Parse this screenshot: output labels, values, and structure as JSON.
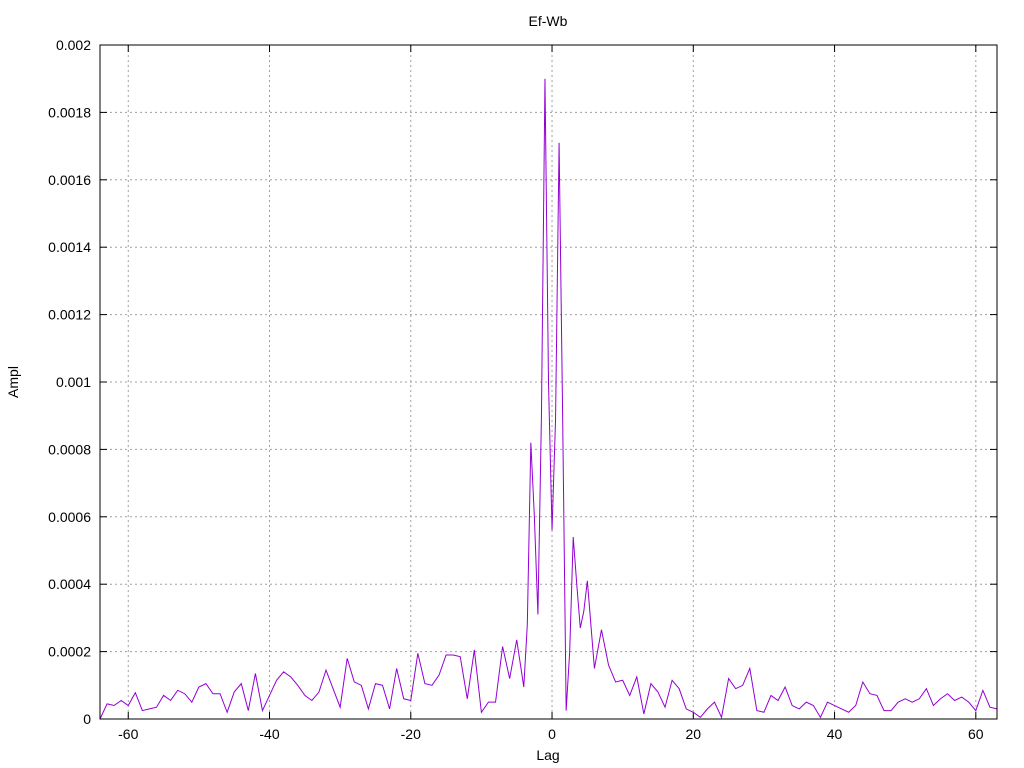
{
  "chart_data": {
    "type": "line",
    "title": "Ef-Wb",
    "xlabel": "Lag",
    "ylabel": "Ampl",
    "xlim": [
      -64,
      63
    ],
    "ylim": [
      0,
      0.002
    ],
    "grid": true,
    "line_color": "#9400d3",
    "x_ticks": [
      -60,
      -40,
      -20,
      0,
      20,
      40,
      60
    ],
    "x_tick_labels": [
      "-60",
      "-40",
      "-20",
      "0",
      "20",
      "40",
      "60"
    ],
    "y_ticks": [
      0,
      0.0002,
      0.0004,
      0.0006,
      0.0008,
      0.001,
      0.0012,
      0.0014,
      0.0016,
      0.0018,
      0.002
    ],
    "y_tick_labels": [
      "0",
      "0.0002",
      "0.0004",
      "0.0006",
      "0.0008",
      "0.001",
      "0.0012",
      "0.0014",
      "0.0016",
      "0.0018",
      "0.002"
    ],
    "series": [
      {
        "x": [
          -64,
          -63,
          -62,
          -61,
          -60,
          -59,
          -58,
          -57,
          -56,
          -55,
          -54,
          -53,
          -52,
          -51,
          -50,
          -49,
          -48,
          -47,
          -46,
          -45,
          -44,
          -43,
          -42,
          -41,
          -40,
          -39,
          -38,
          -37,
          -36,
          -35,
          -34,
          -33,
          -32,
          -31,
          -30,
          -29,
          -28,
          -27,
          -26,
          -25,
          -24,
          -23,
          -22,
          -21,
          -20,
          -19,
          -18,
          -17,
          -16,
          -15,
          -14,
          -13,
          -12,
          -11,
          -10,
          -9,
          -8,
          -7,
          -6,
          -5,
          -4,
          -3.5,
          -3,
          -2.5,
          -2,
          -1.5,
          -1,
          -0.5,
          0,
          0.5,
          1,
          1.5,
          2,
          2.5,
          3,
          3.5,
          4,
          4.5,
          5,
          6,
          7,
          8,
          9,
          10,
          11,
          12,
          13,
          14,
          15,
          16,
          17,
          18,
          19,
          20,
          21,
          22,
          23,
          24,
          25,
          26,
          27,
          28,
          29,
          30,
          31,
          32,
          33,
          34,
          35,
          36,
          37,
          38,
          39,
          40,
          41,
          42,
          43,
          44,
          45,
          46,
          47,
          48,
          49,
          50,
          51,
          52,
          53,
          54,
          55,
          56,
          57,
          58,
          59,
          60,
          61,
          62,
          63
        ],
        "y": [
          0.0,
          4.5e-05,
          4e-05,
          5.5e-05,
          4e-05,
          7.8e-05,
          2.5e-05,
          3e-05,
          3.5e-05,
          7e-05,
          5.5e-05,
          8.5e-05,
          7.5e-05,
          5e-05,
          9.5e-05,
          0.000105,
          7.5e-05,
          7.5e-05,
          2e-05,
          8e-05,
          0.000105,
          2.5e-05,
          0.000135,
          2.5e-05,
          7e-05,
          0.000115,
          0.00014,
          0.000125,
          0.0001,
          7e-05,
          5.5e-05,
          8e-05,
          0.000145,
          9e-05,
          3.5e-05,
          0.00018,
          0.00011,
          0.0001,
          3e-05,
          0.000105,
          0.0001,
          3e-05,
          0.00015,
          6e-05,
          5.5e-05,
          0.000195,
          0.000105,
          0.0001,
          0.00013,
          0.00019,
          0.00019,
          0.000185,
          6e-05,
          0.000205,
          2e-05,
          5e-05,
          5e-05,
          0.000215,
          0.00012,
          0.000235,
          9.5e-05,
          0.00028,
          0.00082,
          0.0006,
          0.00031,
          0.0009,
          0.0019,
          0.001,
          0.00056,
          0.00089,
          0.00171,
          0.0009,
          2.5e-05,
          0.0002,
          0.00054,
          0.0004,
          0.00027,
          0.00032,
          0.00041,
          0.00015,
          0.000265,
          0.00016,
          0.00011,
          0.000115,
          7e-05,
          0.000125,
          1.5e-05,
          0.000105,
          8e-05,
          3.5e-05,
          0.000115,
          9e-05,
          3e-05,
          2e-05,
          5e-06,
          3e-05,
          5e-05,
          5e-06,
          0.00012,
          9e-05,
          0.0001,
          0.00015,
          2.5e-05,
          2e-05,
          7e-05,
          5.5e-05,
          9.5e-05,
          4e-05,
          3e-05,
          5e-05,
          4e-05,
          5e-06,
          5e-05,
          4e-05,
          3e-05,
          2e-05,
          4e-05,
          0.00011,
          7.5e-05,
          7e-05,
          2.5e-05,
          2.5e-05,
          5e-05,
          6e-05,
          5e-05,
          6e-05,
          9e-05,
          4e-05,
          6e-05,
          7.5e-05,
          5.5e-05,
          6.5e-05,
          5e-05,
          2.5e-05,
          8.5e-05,
          3.5e-05,
          3e-05
        ]
      }
    ]
  }
}
